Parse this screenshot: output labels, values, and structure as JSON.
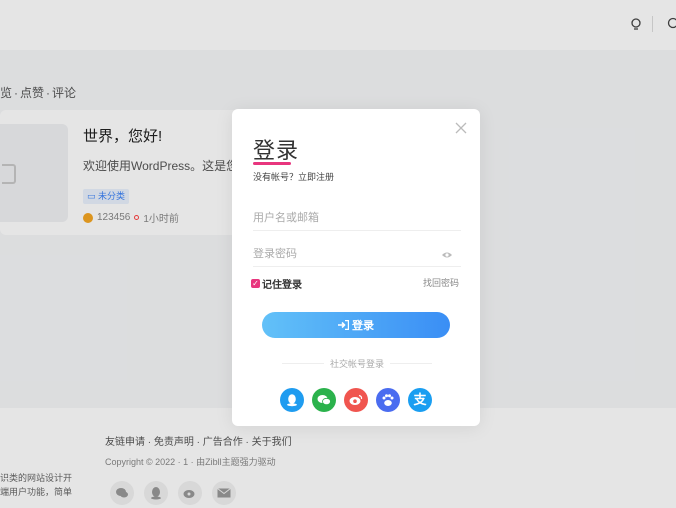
{
  "sortbar": {
    "items": [
      "览",
      "·",
      "点赞",
      "·",
      "评论"
    ]
  },
  "post": {
    "title": "世界，您好!",
    "excerpt": "欢迎使用WordPress。这是您的第一篇文章",
    "category": "未分类",
    "author": "123456",
    "time": "1小时前"
  },
  "footer": {
    "links": "友链申请 · 免责声明 · 广告合作 · 关于我们",
    "copyright": "Copyright © 2022 · 1 · 由Zibll主题强力驱动",
    "desc_line1": "识类的网站设计开",
    "desc_line2": "端用户功能，简单"
  },
  "modal": {
    "title": "登录",
    "subtitle": "没有帐号？立即注册",
    "username_placeholder": "用户名或邮箱",
    "password_placeholder": "登录密码",
    "remember_label": "记住登录",
    "forgot_label": "找回密码",
    "login_button": "登录",
    "social_title": "社交帐号登录",
    "social": [
      "qq-icon",
      "wechat-icon",
      "weibo-icon",
      "baidu-icon",
      "alipay-icon"
    ]
  },
  "colors": {
    "accent_pink": "#e8367e",
    "button_start": "#62c1f8",
    "button_end": "#3a8ef5",
    "qq": "#1f9cf0",
    "wechat": "#2bb24c",
    "weibo": "#f0554f",
    "baidu": "#4a6cf0",
    "alipay": "#1a9ef1"
  }
}
